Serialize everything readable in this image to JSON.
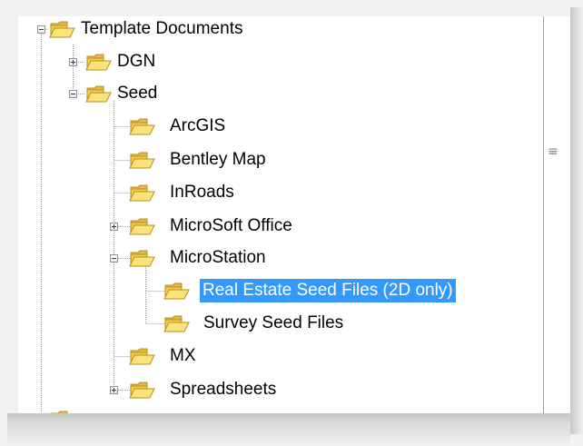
{
  "tree": {
    "root": {
      "label": "Template Documents",
      "expanded": true
    },
    "dgn": {
      "label": "DGN",
      "expanded": false
    },
    "seed": {
      "label": "Seed",
      "expanded": true
    },
    "arcgis": {
      "label": "ArcGIS"
    },
    "bentley_map": {
      "label": "Bentley Map"
    },
    "inroads": {
      "label": "InRoads"
    },
    "microsoft_office": {
      "label": "MicroSoft Office",
      "expanded": false
    },
    "microstation": {
      "label": "MicroStation",
      "expanded": true
    },
    "real_estate": {
      "label": "Real Estate Seed Files (2D only)",
      "selected": true
    },
    "survey": {
      "label": "Survey Seed Files"
    },
    "mx": {
      "label": "MX"
    },
    "spreadsheets": {
      "label": "Spreadsheets",
      "expanded": false
    }
  },
  "colors": {
    "selection": "#3399ff",
    "folder_fill": "#f7d35a",
    "folder_edge": "#b8901c"
  },
  "icons": {
    "folder": "open-folder-icon",
    "expand": "plus-box-icon",
    "collapse": "minus-box-icon",
    "grip": "splitter-grip-icon"
  }
}
